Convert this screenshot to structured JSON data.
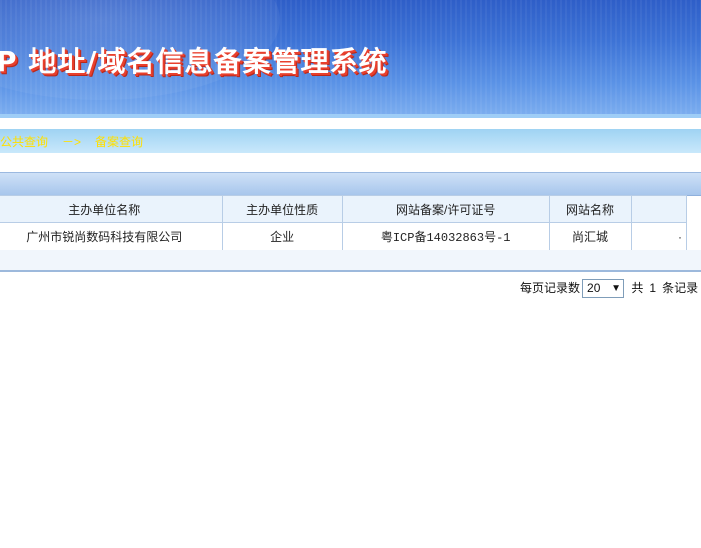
{
  "header": {
    "title": "P 地址/域名信息备案管理系统"
  },
  "breadcrumb": {
    "home": "公共查询",
    "separator": "－>",
    "current": "备案查询"
  },
  "table": {
    "columns": [
      "主办单位名称",
      "主办单位性质",
      "网站备案/许可证号",
      "网站名称",
      ""
    ],
    "rows": [
      [
        "广州市锐尚数码科技有限公司",
        "企业",
        "粤ICP备14032863号-1",
        "尚汇城",
        "·"
      ]
    ]
  },
  "pager": {
    "per_page_label": "每页记录数",
    "per_page_value": "20",
    "total_prefix": "共",
    "total_count": "1",
    "total_suffix": "条记录"
  },
  "colors": {
    "header_blue": "#3d73d6",
    "title_shadow_red": "#e93f2c",
    "breadcrumb_yellow": "#ffe000"
  }
}
